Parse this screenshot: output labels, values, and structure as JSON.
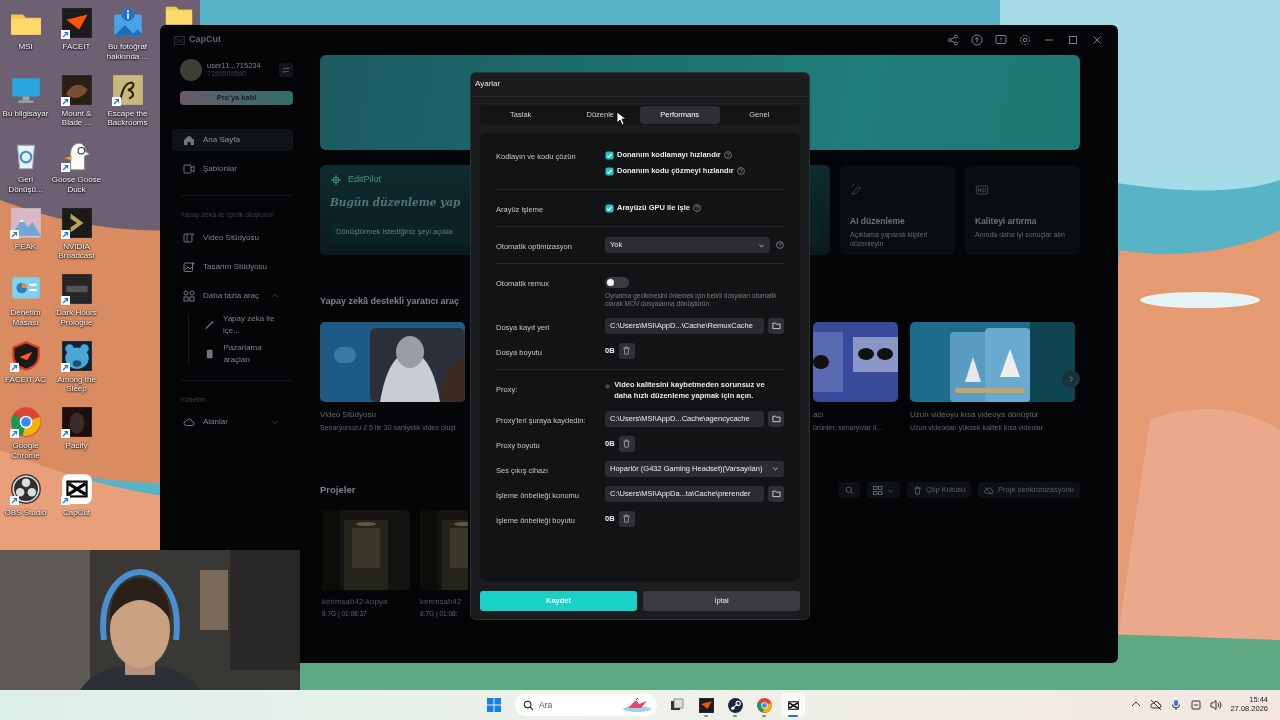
{
  "desktop": {
    "icons": [
      {
        "label": "MSI",
        "shortcut": false
      },
      {
        "label": "Bu bilgisayar",
        "shortcut": false
      },
      {
        "label": "Geri Dönüşü...",
        "shortcut": false
      },
      {
        "label": "PEAK",
        "shortcut": true
      },
      {
        "label": "Denetim Masası",
        "shortcut": false
      },
      {
        "label": "FACEIT AC",
        "shortcut": true
      },
      {
        "label": "Google Chrome",
        "shortcut": true
      },
      {
        "label": "OBS Studio",
        "shortcut": true
      },
      {
        "label": "FACEIT",
        "shortcut": true
      },
      {
        "label": "Mount & Blade ...",
        "shortcut": true
      },
      {
        "label": "Goose Goose Duck",
        "shortcut": true
      },
      {
        "label": "NVIDIA Broadcast",
        "shortcut": true
      },
      {
        "label": "Dark Hours Prologue",
        "shortcut": true
      },
      {
        "label": "Among the Sleep",
        "shortcut": true
      },
      {
        "label": "Pacify",
        "shortcut": true
      },
      {
        "label": "CapCut",
        "shortcut": true
      },
      {
        "label": "Bu fotoğraf hakkında ...",
        "shortcut": false
      },
      {
        "label": "Escape the Backrooms",
        "shortcut": true
      }
    ]
  },
  "capcut_window": {
    "title": "CapCut",
    "account": {
      "name": "user11...715234",
      "id": "7159509560",
      "upgrade_button": "Pro'ya katıl"
    },
    "nav": [
      {
        "label": "Ana Sayfa",
        "selected": true
      },
      {
        "label": "Şablonlar",
        "selected": false
      }
    ],
    "sections": [
      {
        "title": "Yapay zekâ ile içerik oluşturun",
        "items": [
          {
            "label": "Video Stüdyosu",
            "selected": false
          },
          {
            "label": "Tasarım Stüdyosu",
            "selected": false
          },
          {
            "label": "Daha fazla araç",
            "selected": false,
            "expanded": true,
            "children": [
              {
                "label": "Yapay zeka ile içe...",
                "selected": false
              },
              {
                "label": "Pazarlama araçları",
                "selected": false
              }
            ]
          }
        ]
      },
      {
        "title": "Yönetim",
        "items": [
          {
            "label": "Alanlar",
            "selected": false,
            "expanded": false
          }
        ]
      }
    ],
    "editpilot": {
      "title": "EditPilot",
      "heading": "Bugün düzenleme yap",
      "placeholder": "Dönüştürmek istediğiniz şeyi açıkla"
    },
    "feature_cards": [
      {
        "title": "AI düzenleme",
        "description": "Açıklama yaparak klipleri düzenleyin"
      },
      {
        "title": "Kaliteyi artırma",
        "description": "Anında daha iyi sonuçlar alın"
      }
    ],
    "tools_heading": "Yapay zekâ destekli yaratıcı araç",
    "tool_cards": [
      {
        "title": "Video Stüdyosu",
        "description": "Senaryonuzu 2.5 ile 30 saniyelik video oluşt"
      },
      {
        "title": "acı",
        "description": "ürünler, senaryolar il..."
      },
      {
        "title": "Uzun videoyu kısa videoya dönüştür",
        "description": "Uzun videodan yüksek kaliteli kısa videolar"
      }
    ],
    "projects": {
      "title": "Projeler",
      "trash_button": "Çöp Kutusu",
      "sync_button": "Proje senkronizasyonu",
      "items": [
        {
          "name": "kerimsah42-kopya",
          "meta": "8.7G | 01:08:37"
        },
        {
          "name": "kerimsah42",
          "meta": "8.7G | 01:08:"
        }
      ]
    }
  },
  "dialog": {
    "title": "Ayarlar",
    "tabs": [
      {
        "label": "Taslak",
        "selected": false
      },
      {
        "label": "Düzenle",
        "selected": false
      },
      {
        "label": "Performans",
        "selected": true
      },
      {
        "label": "Genel",
        "selected": false
      }
    ],
    "sections": [
      {
        "rows": [
          {
            "label": "Kodlayın ve kodu çözün",
            "kind": "checks",
            "options": [
              {
                "text": "Donanım kodlamayı hızlandır",
                "checked": true
              },
              {
                "text": "Donanım kodu çözmeyi hızlandır",
                "checked": true
              }
            ]
          }
        ]
      },
      {
        "rows": [
          {
            "label": "Arayüz işleme",
            "kind": "checks",
            "options": [
              {
                "text": "Arayüzü GPU ile işle",
                "checked": true
              }
            ]
          }
        ]
      },
      {
        "rows": [
          {
            "label": "Otomatik optimizasyon",
            "kind": "select",
            "value": "Yok",
            "info": true
          }
        ]
      },
      {
        "rows": [
          {
            "label": "Otomatik remux",
            "kind": "toggle",
            "on": false,
            "hint": "Oynatma gecikmesini önlemek için belirli dosyaları otomatik olarak MOV dosyalarına dönüştürün."
          },
          {
            "label": "Dosya kayıt yeri",
            "kind": "path",
            "value": "C:\\Users\\MSI\\AppD...\\Cache\\RemuxCache"
          },
          {
            "label": "Dosya boyutu",
            "kind": "size",
            "value": "0B"
          }
        ]
      },
      {
        "rows": [
          {
            "label": "Proxy:",
            "kind": "option",
            "checked": false,
            "text": "Video kalitesini kaybetmeden sorunsuz ve daha hızlı düzenleme yapmak için açın."
          },
          {
            "label": "Proxy'leri şuraya kaydedin:",
            "kind": "path",
            "value": "C:\\Users\\MSI\\AppD...Cache\\agencycache"
          },
          {
            "label": "Proxy boyutu",
            "kind": "size",
            "value": "0B"
          },
          {
            "label": "Ses çıkış cihazı",
            "kind": "select",
            "value": "Hoparlör (G432 Gaming Headset)(Varsayılan)",
            "info": false
          },
          {
            "label": "İşleme önbelleği konumu",
            "kind": "path",
            "value": "C:\\Users\\MSI\\AppDa...ta\\Cache\\prerender"
          },
          {
            "label": "İşleme önbelleği boyutu",
            "kind": "size",
            "value": "0B"
          }
        ]
      }
    ],
    "save_button": "Kaydet",
    "cancel_button": "İptal"
  },
  "taskbar": {
    "search_placeholder": "Ara",
    "apps": [
      {
        "open": true,
        "selected": false
      },
      {
        "open": true,
        "selected": false
      },
      {
        "open": true,
        "selected": false
      },
      {
        "open": true,
        "selected": true
      }
    ],
    "time": "15:44",
    "date": "27.08.2026"
  }
}
